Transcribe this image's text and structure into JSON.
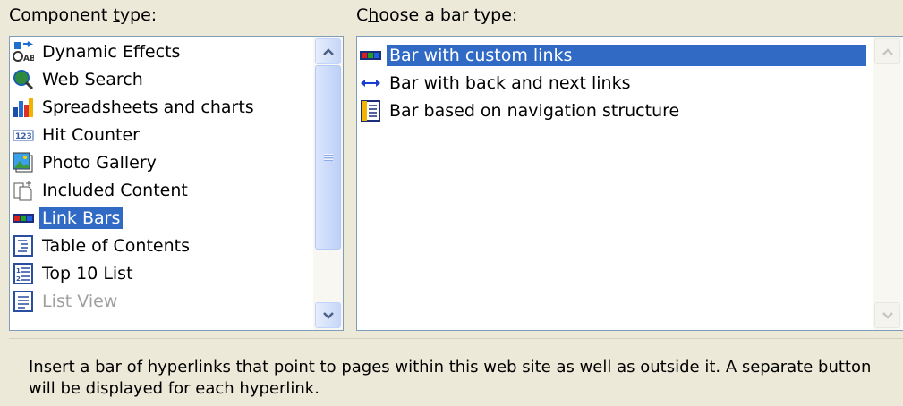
{
  "component_type": {
    "label_pre": "Component ",
    "label_accel": "t",
    "label_post": "ype:",
    "items": [
      {
        "label": "Dynamic Effects",
        "icon": "dynamic-effects-icon"
      },
      {
        "label": "Web Search",
        "icon": "web-search-icon"
      },
      {
        "label": "Spreadsheets and charts",
        "icon": "spreadsheets-icon"
      },
      {
        "label": "Hit Counter",
        "icon": "hit-counter-icon"
      },
      {
        "label": "Photo Gallery",
        "icon": "photo-gallery-icon"
      },
      {
        "label": "Included Content",
        "icon": "included-content-icon"
      },
      {
        "label": "Link Bars",
        "icon": "link-bars-icon",
        "selected": true
      },
      {
        "label": "Table of Contents",
        "icon": "table-of-contents-icon"
      },
      {
        "label": "Top 10 List",
        "icon": "top-10-list-icon"
      },
      {
        "label": "List View",
        "icon": "list-view-icon",
        "disabled": true
      }
    ]
  },
  "bar_type": {
    "label_pre": "C",
    "label_accel": "h",
    "label_post": "oose a bar type:",
    "items": [
      {
        "label": "Bar with custom links",
        "icon": "custom-links-bar-icon",
        "selected": true
      },
      {
        "label": "Bar with back and next links",
        "icon": "back-next-arrows-icon"
      },
      {
        "label": "Bar based on navigation structure",
        "icon": "navigation-structure-icon"
      }
    ]
  },
  "description": "Insert a bar of hyperlinks that point to pages within this web site as well as outside it.  A separate button will be displayed for each hyperlink.",
  "colors": {
    "selection": "#316ac5",
    "dialog_bg": "#ece9d8",
    "list_border": "#7f9db9"
  }
}
